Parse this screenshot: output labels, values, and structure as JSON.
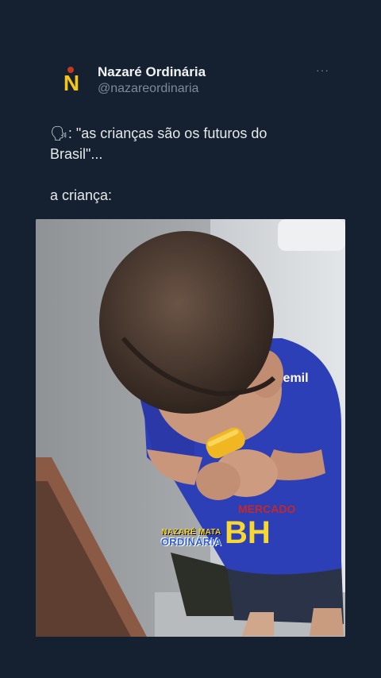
{
  "tweet": {
    "author_name": "Nazaré Ordinária",
    "author_handle": "@nazareordinaria",
    "more_label": "···",
    "text_line1": "🗣: \"as crianças são os futuros do Brasil\"...",
    "text_line2": "a criança:",
    "avatar_letter": "N"
  },
  "media": {
    "watermark_line1": "NAZARÉ MATA",
    "watermark_line2": "ORDINÁRIA",
    "jersey_text_top": "Cemil",
    "jersey_text_mid": "MERCADO",
    "jersey_text_bottom": "BH"
  },
  "colors": {
    "background": "#152030",
    "jersey": "#2d3fb6",
    "watermark_yellow": "#f5d22a",
    "watermark_blue": "#2c5dd8"
  }
}
